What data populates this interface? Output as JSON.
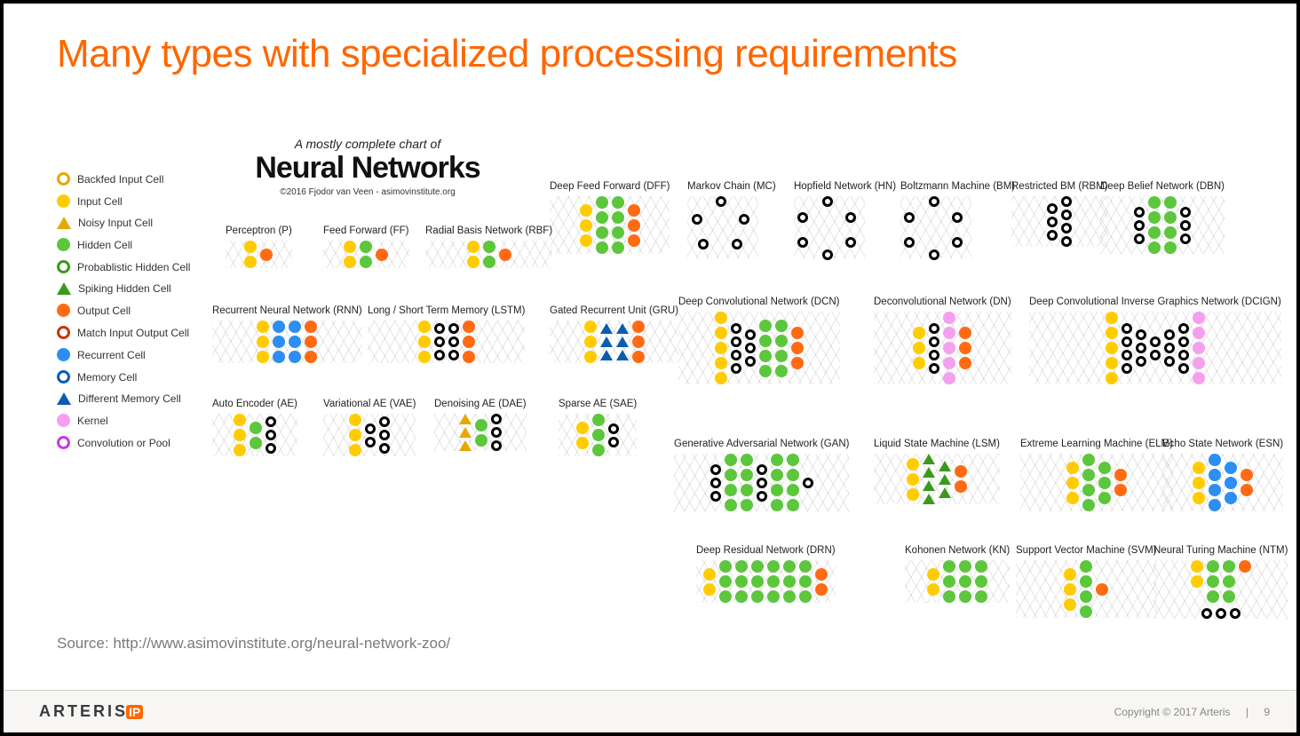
{
  "slide_title": "Many types with specialized processing requirements",
  "chart": {
    "subtitle": "A mostly complete chart of",
    "title": "Neural Networks",
    "credit": "©2016 Fjodor van Veen - asimovinstitute.org"
  },
  "legend": [
    {
      "label": "Backfed Input Cell",
      "type": "ring",
      "color": "#e6a800"
    },
    {
      "label": "Input Cell",
      "type": "solid",
      "color": "#ffcc00"
    },
    {
      "label": "Noisy Input Cell",
      "type": "tri",
      "color": "#e6a800"
    },
    {
      "label": "Hidden Cell",
      "type": "solid",
      "color": "#5cc63c"
    },
    {
      "label": "Probablistic Hidden Cell",
      "type": "ring",
      "color": "#3a9a1f"
    },
    {
      "label": "Spiking Hidden Cell",
      "type": "tri",
      "color": "#3a9a1f"
    },
    {
      "label": "Output Cell",
      "type": "solid",
      "color": "#ff6a13"
    },
    {
      "label": "Match Input Output Cell",
      "type": "ring",
      "color": "#c23800"
    },
    {
      "label": "Recurrent Cell",
      "type": "solid",
      "color": "#2c8ef0"
    },
    {
      "label": "Memory Cell",
      "type": "ring",
      "color": "#0b5db0"
    },
    {
      "label": "Different Memory Cell",
      "type": "tri",
      "color": "#0b5db0"
    },
    {
      "label": "Kernel",
      "type": "solid",
      "color": "#f5a0ef"
    },
    {
      "label": "Convolution or Pool",
      "type": "ring",
      "color": "#c63de0"
    }
  ],
  "networks": {
    "p": "Perceptron (P)",
    "ff": "Feed Forward (FF)",
    "rbf": "Radial Basis Network (RBF)",
    "dff": "Deep Feed Forward (DFF)",
    "rnn": "Recurrent Neural Network (RNN)",
    "lstm": "Long / Short Term Memory (LSTM)",
    "gru": "Gated Recurrent Unit (GRU)",
    "ae": "Auto Encoder (AE)",
    "vae": "Variational AE (VAE)",
    "dae": "Denoising AE (DAE)",
    "sae": "Sparse AE (SAE)",
    "mc": "Markov Chain (MC)",
    "hn": "Hopfield Network (HN)",
    "bm": "Boltzmann Machine (BM)",
    "rbm": "Restricted BM (RBM)",
    "dbn": "Deep Belief Network (DBN)",
    "dcn": "Deep Convolutional Network (DCN)",
    "dn": "Deconvolutional Network (DN)",
    "dcign": "Deep Convolutional Inverse Graphics Network (DCIGN)",
    "gan": "Generative Adversarial Network (GAN)",
    "lsm": "Liquid State Machine (LSM)",
    "elm": "Extreme Learning Machine (ELM)",
    "esn": "Echo State Network (ESN)",
    "drn": "Deep Residual Network (DRN)",
    "kn": "Kohonen Network (KN)",
    "svm": "Support Vector Machine (SVM)",
    "ntm": "Neural Turing Machine (NTM)"
  },
  "source_label": "Source: ",
  "source_url": "http://www.asimovinstitute.org/neural-network-zoo/",
  "footer": {
    "brand": "ARTERIS",
    "brand_suffix": "IP",
    "copyright": "Copyright © 2017 Arteris",
    "separator": "|",
    "page": "9"
  }
}
